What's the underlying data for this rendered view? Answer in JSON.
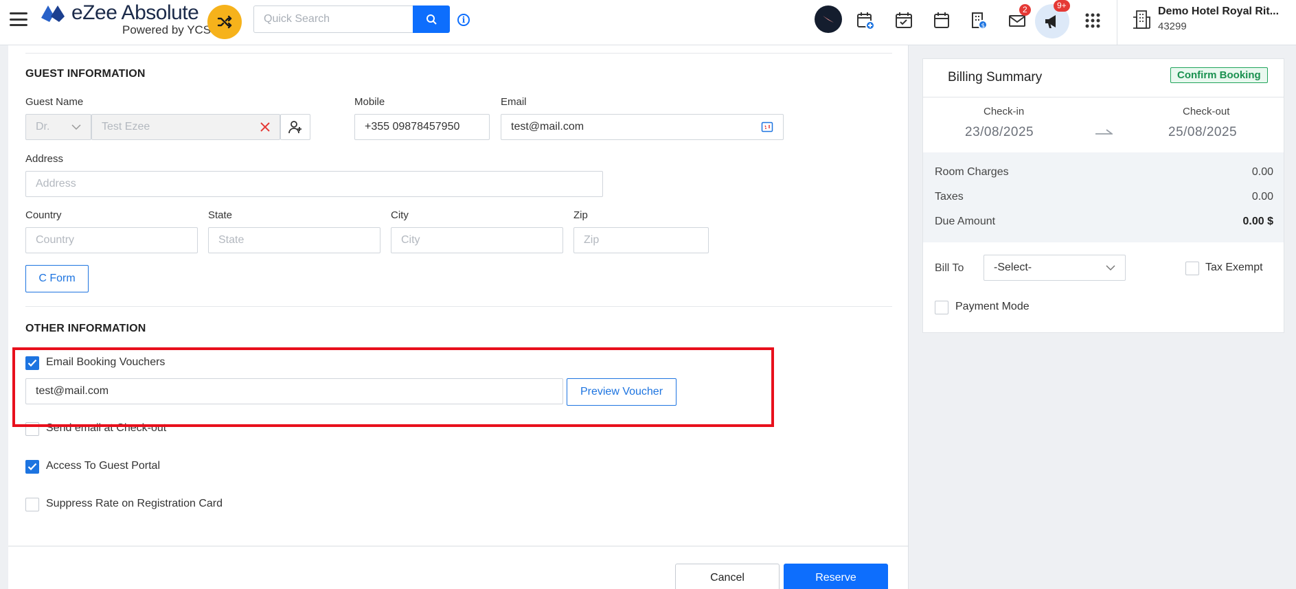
{
  "header": {
    "logo_title": "eZee Absolute",
    "logo_subtitle": "Powered by YCS",
    "search_placeholder": "Quick Search",
    "mail_badge": "2",
    "announce_badge": "9+",
    "hotel_name": "Demo Hotel Royal Rit...",
    "hotel_code": "43299"
  },
  "guest_info": {
    "section_title": "GUEST INFORMATION",
    "guest_name_label": "Guest Name",
    "salutation": "Dr.",
    "guest_name_value": "Test Ezee",
    "mobile_label": "Mobile",
    "mobile_value": "+355 09878457950",
    "email_label": "Email",
    "email_value": "test@mail.com",
    "address_label": "Address",
    "address_placeholder": "Address",
    "country_label": "Country",
    "country_placeholder": "Country",
    "state_label": "State",
    "state_placeholder": "State",
    "city_label": "City",
    "city_placeholder": "City",
    "zip_label": "Zip",
    "zip_placeholder": "Zip",
    "cform_button": "C Form"
  },
  "other_info": {
    "section_title": "OTHER INFORMATION",
    "email_vouchers_label": "Email Booking Vouchers",
    "email_vouchers_checked": true,
    "voucher_email_value": "test@mail.com",
    "preview_voucher_button": "Preview Voucher",
    "send_checkout_label": "Send email at Check-out",
    "send_checkout_checked": false,
    "guest_portal_label": "Access To Guest Portal",
    "guest_portal_checked": true,
    "suppress_rate_label": "Suppress Rate on Registration Card",
    "suppress_rate_checked": false
  },
  "actions": {
    "cancel_button": "Cancel",
    "reserve_button": "Reserve"
  },
  "billing": {
    "title": "Billing Summary",
    "status_badge": "Confirm Booking",
    "checkin_label": "Check-in",
    "checkin_date": "23/08/2025",
    "checkout_label": "Check-out",
    "checkout_date": "25/08/2025",
    "room_charges_label": "Room Charges",
    "room_charges_value": "0.00",
    "taxes_label": "Taxes",
    "taxes_value": "0.00",
    "due_amount_label": "Due Amount",
    "due_amount_value": "0.00 $",
    "bill_to_label": "Bill To",
    "bill_to_value": "-Select-",
    "tax_exempt_label": "Tax Exempt",
    "payment_mode_label": "Payment Mode"
  },
  "colors": {
    "primary": "#0d6efd",
    "accent_yellow": "#f6b21b",
    "highlight_red": "#e8101c",
    "success_green": "#1a9150"
  }
}
